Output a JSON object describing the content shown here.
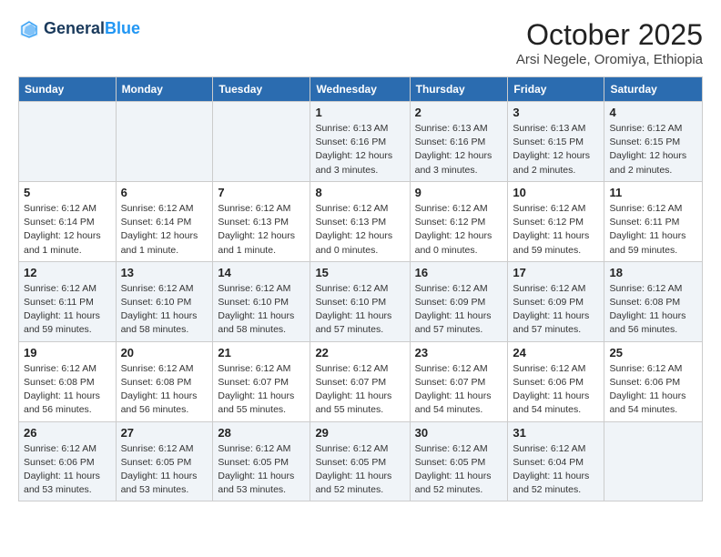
{
  "header": {
    "logo_line1": "General",
    "logo_line2": "Blue",
    "month": "October 2025",
    "location": "Arsi Negele, Oromiya, Ethiopia"
  },
  "days_of_week": [
    "Sunday",
    "Monday",
    "Tuesday",
    "Wednesday",
    "Thursday",
    "Friday",
    "Saturday"
  ],
  "weeks": [
    [
      {
        "day": "",
        "info": ""
      },
      {
        "day": "",
        "info": ""
      },
      {
        "day": "",
        "info": ""
      },
      {
        "day": "1",
        "info": "Sunrise: 6:13 AM\nSunset: 6:16 PM\nDaylight: 12 hours\nand 3 minutes."
      },
      {
        "day": "2",
        "info": "Sunrise: 6:13 AM\nSunset: 6:16 PM\nDaylight: 12 hours\nand 3 minutes."
      },
      {
        "day": "3",
        "info": "Sunrise: 6:13 AM\nSunset: 6:15 PM\nDaylight: 12 hours\nand 2 minutes."
      },
      {
        "day": "4",
        "info": "Sunrise: 6:12 AM\nSunset: 6:15 PM\nDaylight: 12 hours\nand 2 minutes."
      }
    ],
    [
      {
        "day": "5",
        "info": "Sunrise: 6:12 AM\nSunset: 6:14 PM\nDaylight: 12 hours\nand 1 minute."
      },
      {
        "day": "6",
        "info": "Sunrise: 6:12 AM\nSunset: 6:14 PM\nDaylight: 12 hours\nand 1 minute."
      },
      {
        "day": "7",
        "info": "Sunrise: 6:12 AM\nSunset: 6:13 PM\nDaylight: 12 hours\nand 1 minute."
      },
      {
        "day": "8",
        "info": "Sunrise: 6:12 AM\nSunset: 6:13 PM\nDaylight: 12 hours\nand 0 minutes."
      },
      {
        "day": "9",
        "info": "Sunrise: 6:12 AM\nSunset: 6:12 PM\nDaylight: 12 hours\nand 0 minutes."
      },
      {
        "day": "10",
        "info": "Sunrise: 6:12 AM\nSunset: 6:12 PM\nDaylight: 11 hours\nand 59 minutes."
      },
      {
        "day": "11",
        "info": "Sunrise: 6:12 AM\nSunset: 6:11 PM\nDaylight: 11 hours\nand 59 minutes."
      }
    ],
    [
      {
        "day": "12",
        "info": "Sunrise: 6:12 AM\nSunset: 6:11 PM\nDaylight: 11 hours\nand 59 minutes."
      },
      {
        "day": "13",
        "info": "Sunrise: 6:12 AM\nSunset: 6:10 PM\nDaylight: 11 hours\nand 58 minutes."
      },
      {
        "day": "14",
        "info": "Sunrise: 6:12 AM\nSunset: 6:10 PM\nDaylight: 11 hours\nand 58 minutes."
      },
      {
        "day": "15",
        "info": "Sunrise: 6:12 AM\nSunset: 6:10 PM\nDaylight: 11 hours\nand 57 minutes."
      },
      {
        "day": "16",
        "info": "Sunrise: 6:12 AM\nSunset: 6:09 PM\nDaylight: 11 hours\nand 57 minutes."
      },
      {
        "day": "17",
        "info": "Sunrise: 6:12 AM\nSunset: 6:09 PM\nDaylight: 11 hours\nand 57 minutes."
      },
      {
        "day": "18",
        "info": "Sunrise: 6:12 AM\nSunset: 6:08 PM\nDaylight: 11 hours\nand 56 minutes."
      }
    ],
    [
      {
        "day": "19",
        "info": "Sunrise: 6:12 AM\nSunset: 6:08 PM\nDaylight: 11 hours\nand 56 minutes."
      },
      {
        "day": "20",
        "info": "Sunrise: 6:12 AM\nSunset: 6:08 PM\nDaylight: 11 hours\nand 56 minutes."
      },
      {
        "day": "21",
        "info": "Sunrise: 6:12 AM\nSunset: 6:07 PM\nDaylight: 11 hours\nand 55 minutes."
      },
      {
        "day": "22",
        "info": "Sunrise: 6:12 AM\nSunset: 6:07 PM\nDaylight: 11 hours\nand 55 minutes."
      },
      {
        "day": "23",
        "info": "Sunrise: 6:12 AM\nSunset: 6:07 PM\nDaylight: 11 hours\nand 54 minutes."
      },
      {
        "day": "24",
        "info": "Sunrise: 6:12 AM\nSunset: 6:06 PM\nDaylight: 11 hours\nand 54 minutes."
      },
      {
        "day": "25",
        "info": "Sunrise: 6:12 AM\nSunset: 6:06 PM\nDaylight: 11 hours\nand 54 minutes."
      }
    ],
    [
      {
        "day": "26",
        "info": "Sunrise: 6:12 AM\nSunset: 6:06 PM\nDaylight: 11 hours\nand 53 minutes."
      },
      {
        "day": "27",
        "info": "Sunrise: 6:12 AM\nSunset: 6:05 PM\nDaylight: 11 hours\nand 53 minutes."
      },
      {
        "day": "28",
        "info": "Sunrise: 6:12 AM\nSunset: 6:05 PM\nDaylight: 11 hours\nand 53 minutes."
      },
      {
        "day": "29",
        "info": "Sunrise: 6:12 AM\nSunset: 6:05 PM\nDaylight: 11 hours\nand 52 minutes."
      },
      {
        "day": "30",
        "info": "Sunrise: 6:12 AM\nSunset: 6:05 PM\nDaylight: 11 hours\nand 52 minutes."
      },
      {
        "day": "31",
        "info": "Sunrise: 6:12 AM\nSunset: 6:04 PM\nDaylight: 11 hours\nand 52 minutes."
      },
      {
        "day": "",
        "info": ""
      }
    ]
  ]
}
